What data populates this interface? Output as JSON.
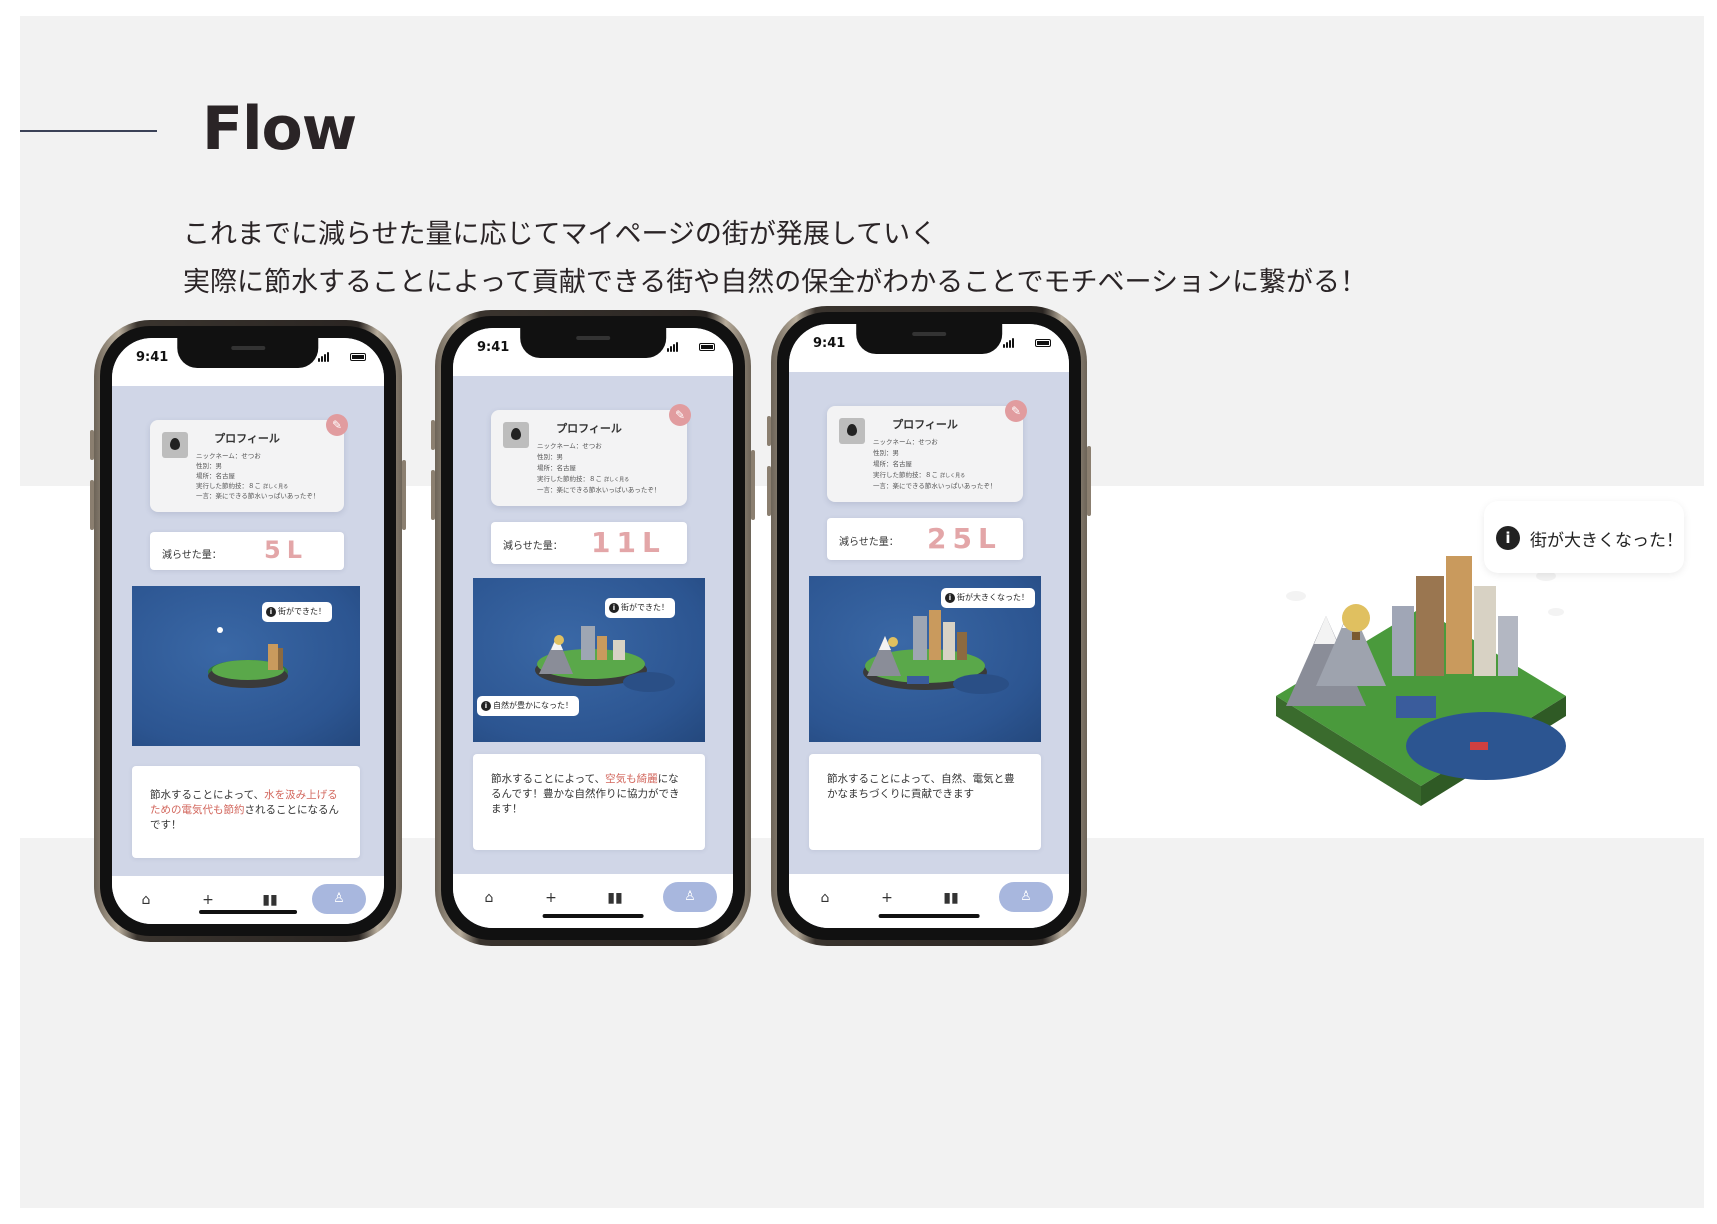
{
  "slide": {
    "title": "Flow",
    "description_line1": "これまでに減らせた量に応じてマイページの街が発展していく",
    "description_line2": "実際に節水することによって貢献できる街や自然の保全がわかることでモチベーションに繋がる！"
  },
  "phones": [
    {
      "time": "9:41",
      "profile": {
        "title": "プロフィール",
        "nickname": "ニックネーム：せつお",
        "gender": "性別：男",
        "place": "場所：名古屋",
        "methods": "実行した節約技：８こ",
        "methods_note": "詳しく見る",
        "comment": "一言：楽にできる節水いっぱいあったぞ！"
      },
      "amount_label": "減らせた量：",
      "amount_value": "5L",
      "bubbles": [
        "街ができた！"
      ],
      "message_parts": [
        "節水することによって、",
        "水を汲み上げるための電気代も節約",
        "されることになるんです！"
      ]
    },
    {
      "time": "9:41",
      "profile": {
        "title": "プロフィール",
        "nickname": "ニックネーム：せつお",
        "gender": "性別：男",
        "place": "場所：名古屋",
        "methods": "実行した節約技：８こ",
        "methods_note": "詳しく見る",
        "comment": "一言：楽にできる節水いっぱいあったぞ！"
      },
      "amount_label": "減らせた量：",
      "amount_value": "11L",
      "bubbles": [
        "街ができた！",
        "自然が豊かになった！"
      ],
      "message_parts": [
        "節水することによって、",
        "空気も綺麗",
        "になるんです！豊かな自然作りに協力ができます！"
      ]
    },
    {
      "time": "9:41",
      "profile": {
        "title": "プロフィール",
        "nickname": "ニックネーム：せつお",
        "gender": "性別：男",
        "place": "場所：名古屋",
        "methods": "実行した節約技：８こ",
        "methods_note": "詳しく見る",
        "comment": "一言：楽にできる節水いっぱいあったぞ！"
      },
      "amount_label": "減らせた量：",
      "amount_value": "25L",
      "bubbles": [
        "街が大きくなった！"
      ],
      "message_parts": [
        "節水することによって、自然、電気と豊かなまちづくりに貢献できます"
      ]
    }
  ],
  "city_bubble": "街が大きくなった！",
  "colors": {
    "background": "#f2f2f2",
    "screen": "#d0d6e7",
    "amount": "#e3a6a8",
    "highlight": "#d2665c",
    "tab_active": "#a8b7de",
    "edit": "#e19c9f",
    "sea": "#2c5591"
  },
  "icons": {
    "tabs": [
      "home-icon",
      "plus-icon",
      "book-icon",
      "user-icon"
    ],
    "edit": "pencil-icon",
    "info": "info-icon"
  }
}
